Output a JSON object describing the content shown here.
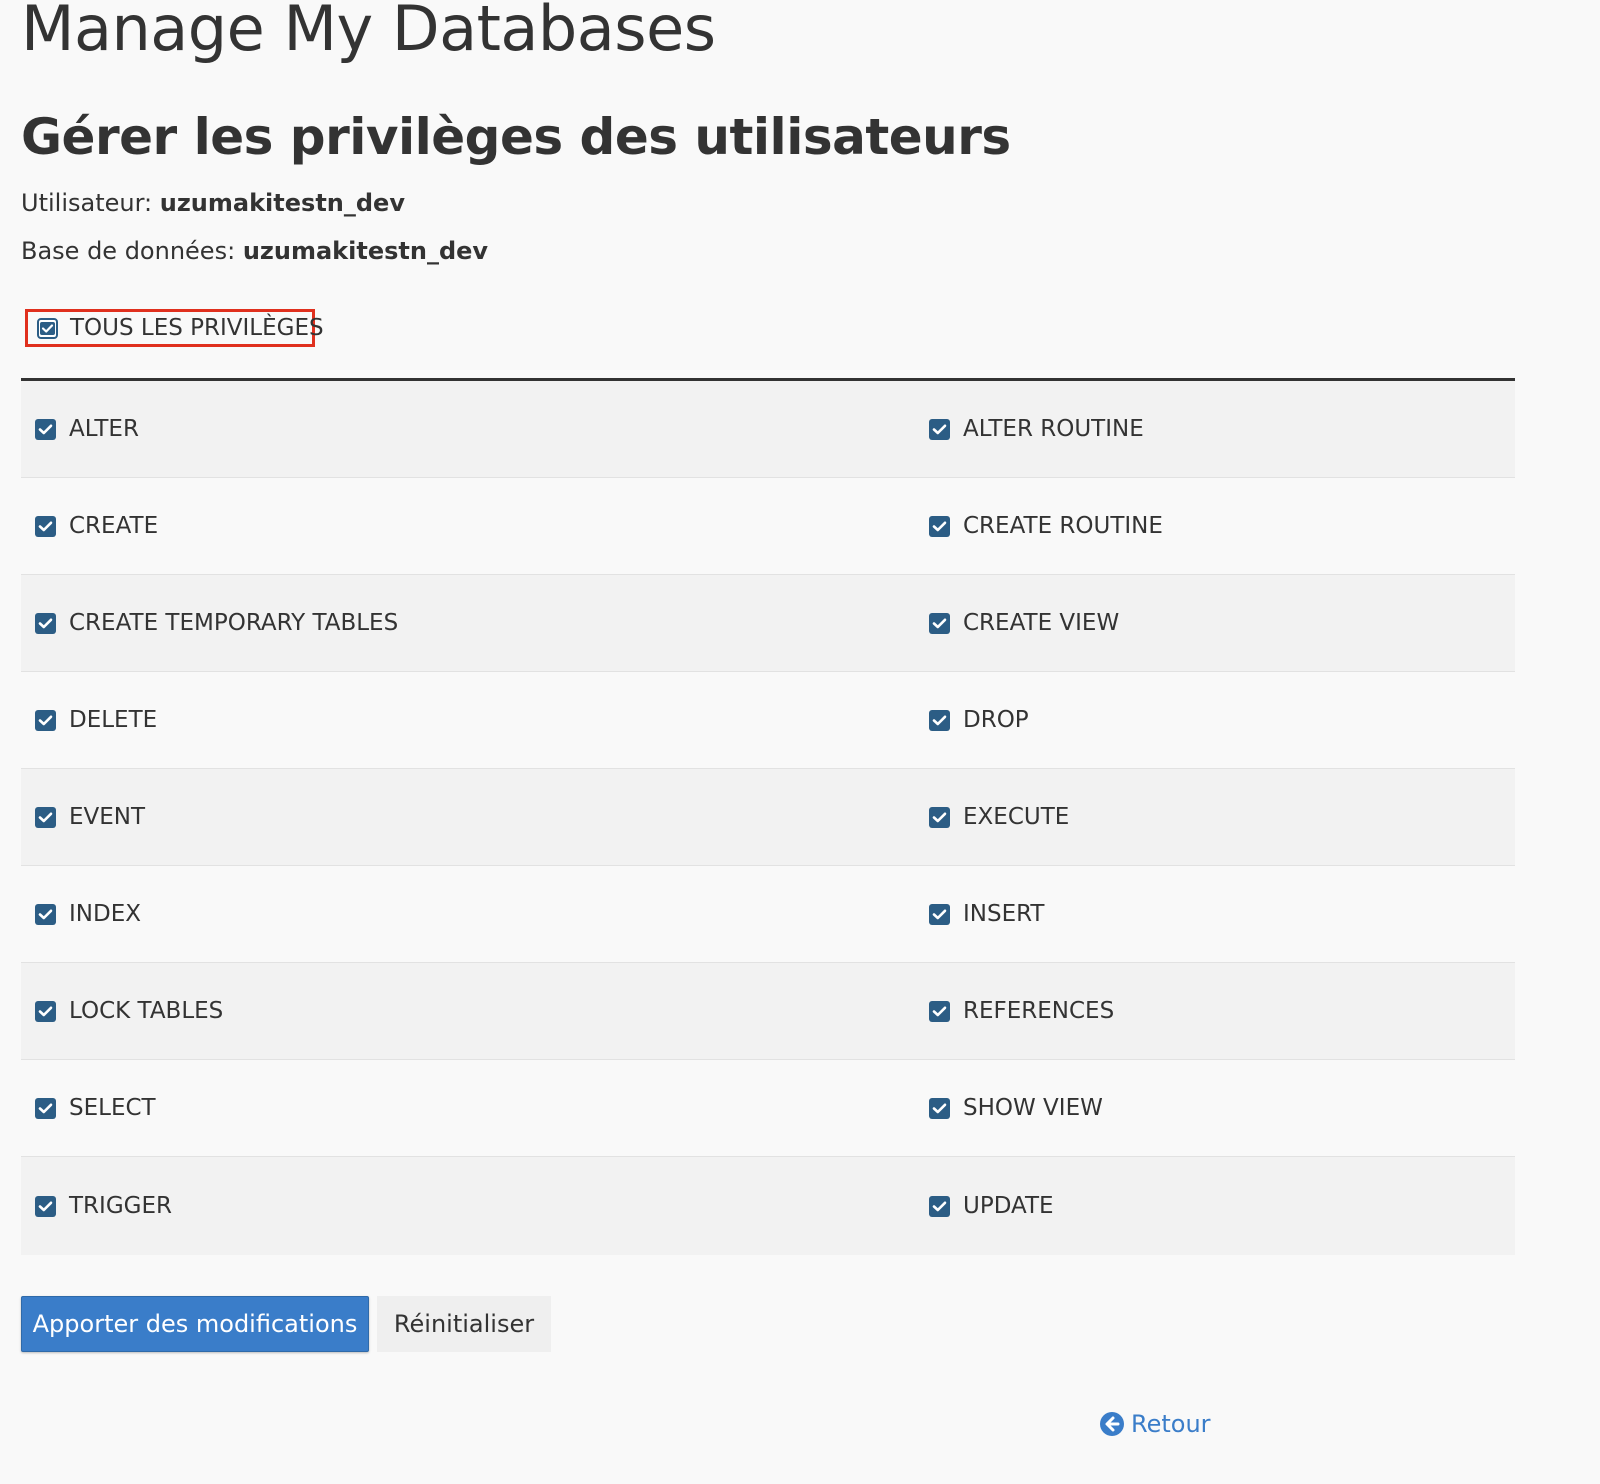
{
  "app_title": "Manage My Databases",
  "page_title": "Gérer les privilèges des utilisateurs",
  "meta": {
    "user_label": "Utilisateur:",
    "user_value": "uzumakitestn_dev",
    "db_label": "Base de données:",
    "db_value": "uzumakitestn_dev"
  },
  "all_privileges": {
    "label": "TOUS LES PRIVILÈGES",
    "checked": true
  },
  "privileges": [
    {
      "left": "ALTER",
      "right": "ALTER ROUTINE"
    },
    {
      "left": "CREATE",
      "right": "CREATE ROUTINE"
    },
    {
      "left": "CREATE TEMPORARY TABLES",
      "right": "CREATE VIEW"
    },
    {
      "left": "DELETE",
      "right": "DROP"
    },
    {
      "left": "EVENT",
      "right": "EXECUTE"
    },
    {
      "left": "INDEX",
      "right": "INSERT"
    },
    {
      "left": "LOCK TABLES",
      "right": "REFERENCES"
    },
    {
      "left": "SELECT",
      "right": "SHOW VIEW"
    },
    {
      "left": "TRIGGER",
      "right": "UPDATE"
    }
  ],
  "all_checked": true,
  "actions": {
    "submit_label": "Apporter des modifications",
    "reset_label": "Réinitialiser"
  },
  "back_link": {
    "label": "Retour",
    "icon": "arrow-circle-left-icon"
  },
  "colors": {
    "checkbox": "#2c5d85",
    "primary_button": "#3a7dc9",
    "highlight_border": "#e0301e",
    "link": "#3a7dc9"
  }
}
